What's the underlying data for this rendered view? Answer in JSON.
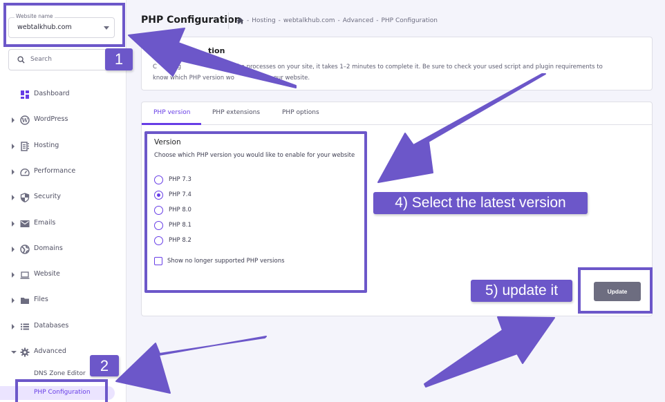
{
  "sidebar": {
    "website_select": {
      "legend": "Website name",
      "value": "webtalkhub.com"
    },
    "search": {
      "placeholder": "Search"
    },
    "items": [
      {
        "label": "Dashboard",
        "icon": "dashboard-icon",
        "expandable": false
      },
      {
        "label": "WordPress",
        "icon": "wordpress-icon",
        "expandable": true
      },
      {
        "label": "Hosting",
        "icon": "hosting-icon",
        "expandable": true
      },
      {
        "label": "Performance",
        "icon": "gauge-icon",
        "expandable": true
      },
      {
        "label": "Security",
        "icon": "shield-icon",
        "expandable": true
      },
      {
        "label": "Emails",
        "icon": "envelope-icon",
        "expandable": true
      },
      {
        "label": "Domains",
        "icon": "globe-icon",
        "expandable": true
      },
      {
        "label": "Website",
        "icon": "laptop-icon",
        "expandable": true
      },
      {
        "label": "Files",
        "icon": "folder-icon",
        "expandable": true
      },
      {
        "label": "Databases",
        "icon": "list-icon",
        "expandable": true
      },
      {
        "label": "Advanced",
        "icon": "gear-icon",
        "expandable": true,
        "expanded": true
      }
    ],
    "sub_items": [
      {
        "label": "DNS Zone Editor",
        "active": false
      },
      {
        "label": "PHP Configuration",
        "active": true
      }
    ]
  },
  "header": {
    "title": "PHP Configuration",
    "breadcrumb": [
      "Hosting",
      "webtalkhub.com",
      "Advanced",
      "PHP Configuration"
    ]
  },
  "info_card": {
    "title_visible_fragment": "tion",
    "desc_line1_visible": "C         ng                  top all the processes on your site, it takes 1–2 minutes to complete it. Be sure to check your used script and plugin requirements to",
    "desc_line2_visible": "know which PHP version wo                     our website."
  },
  "tabs": [
    {
      "label": "PHP version",
      "active": true
    },
    {
      "label": "PHP extensions",
      "active": false
    },
    {
      "label": "PHP options",
      "active": false
    }
  ],
  "version_section": {
    "title": "Version",
    "description": "Choose which PHP version you would like to enable for your website",
    "options": [
      {
        "label": "PHP 7.3",
        "checked": false
      },
      {
        "label": "PHP 7.4",
        "checked": true
      },
      {
        "label": "PHP 8.0",
        "checked": false
      },
      {
        "label": "PHP 8.1",
        "checked": false
      },
      {
        "label": "PHP 8.2",
        "checked": false
      }
    ],
    "show_unsupported": {
      "label": "Show no longer supported PHP versions",
      "checked": false
    }
  },
  "update_button": {
    "label": "Update"
  },
  "annotations": {
    "step1": "1",
    "step2": "2",
    "step4": "4) Select the latest version",
    "step5": "5) update it",
    "color": "#6c57c9"
  },
  "colors": {
    "accent": "#673de6",
    "annotation": "#6c57c9",
    "button_disabled": "#6d6d80",
    "page_bg": "#f4f4fb"
  }
}
